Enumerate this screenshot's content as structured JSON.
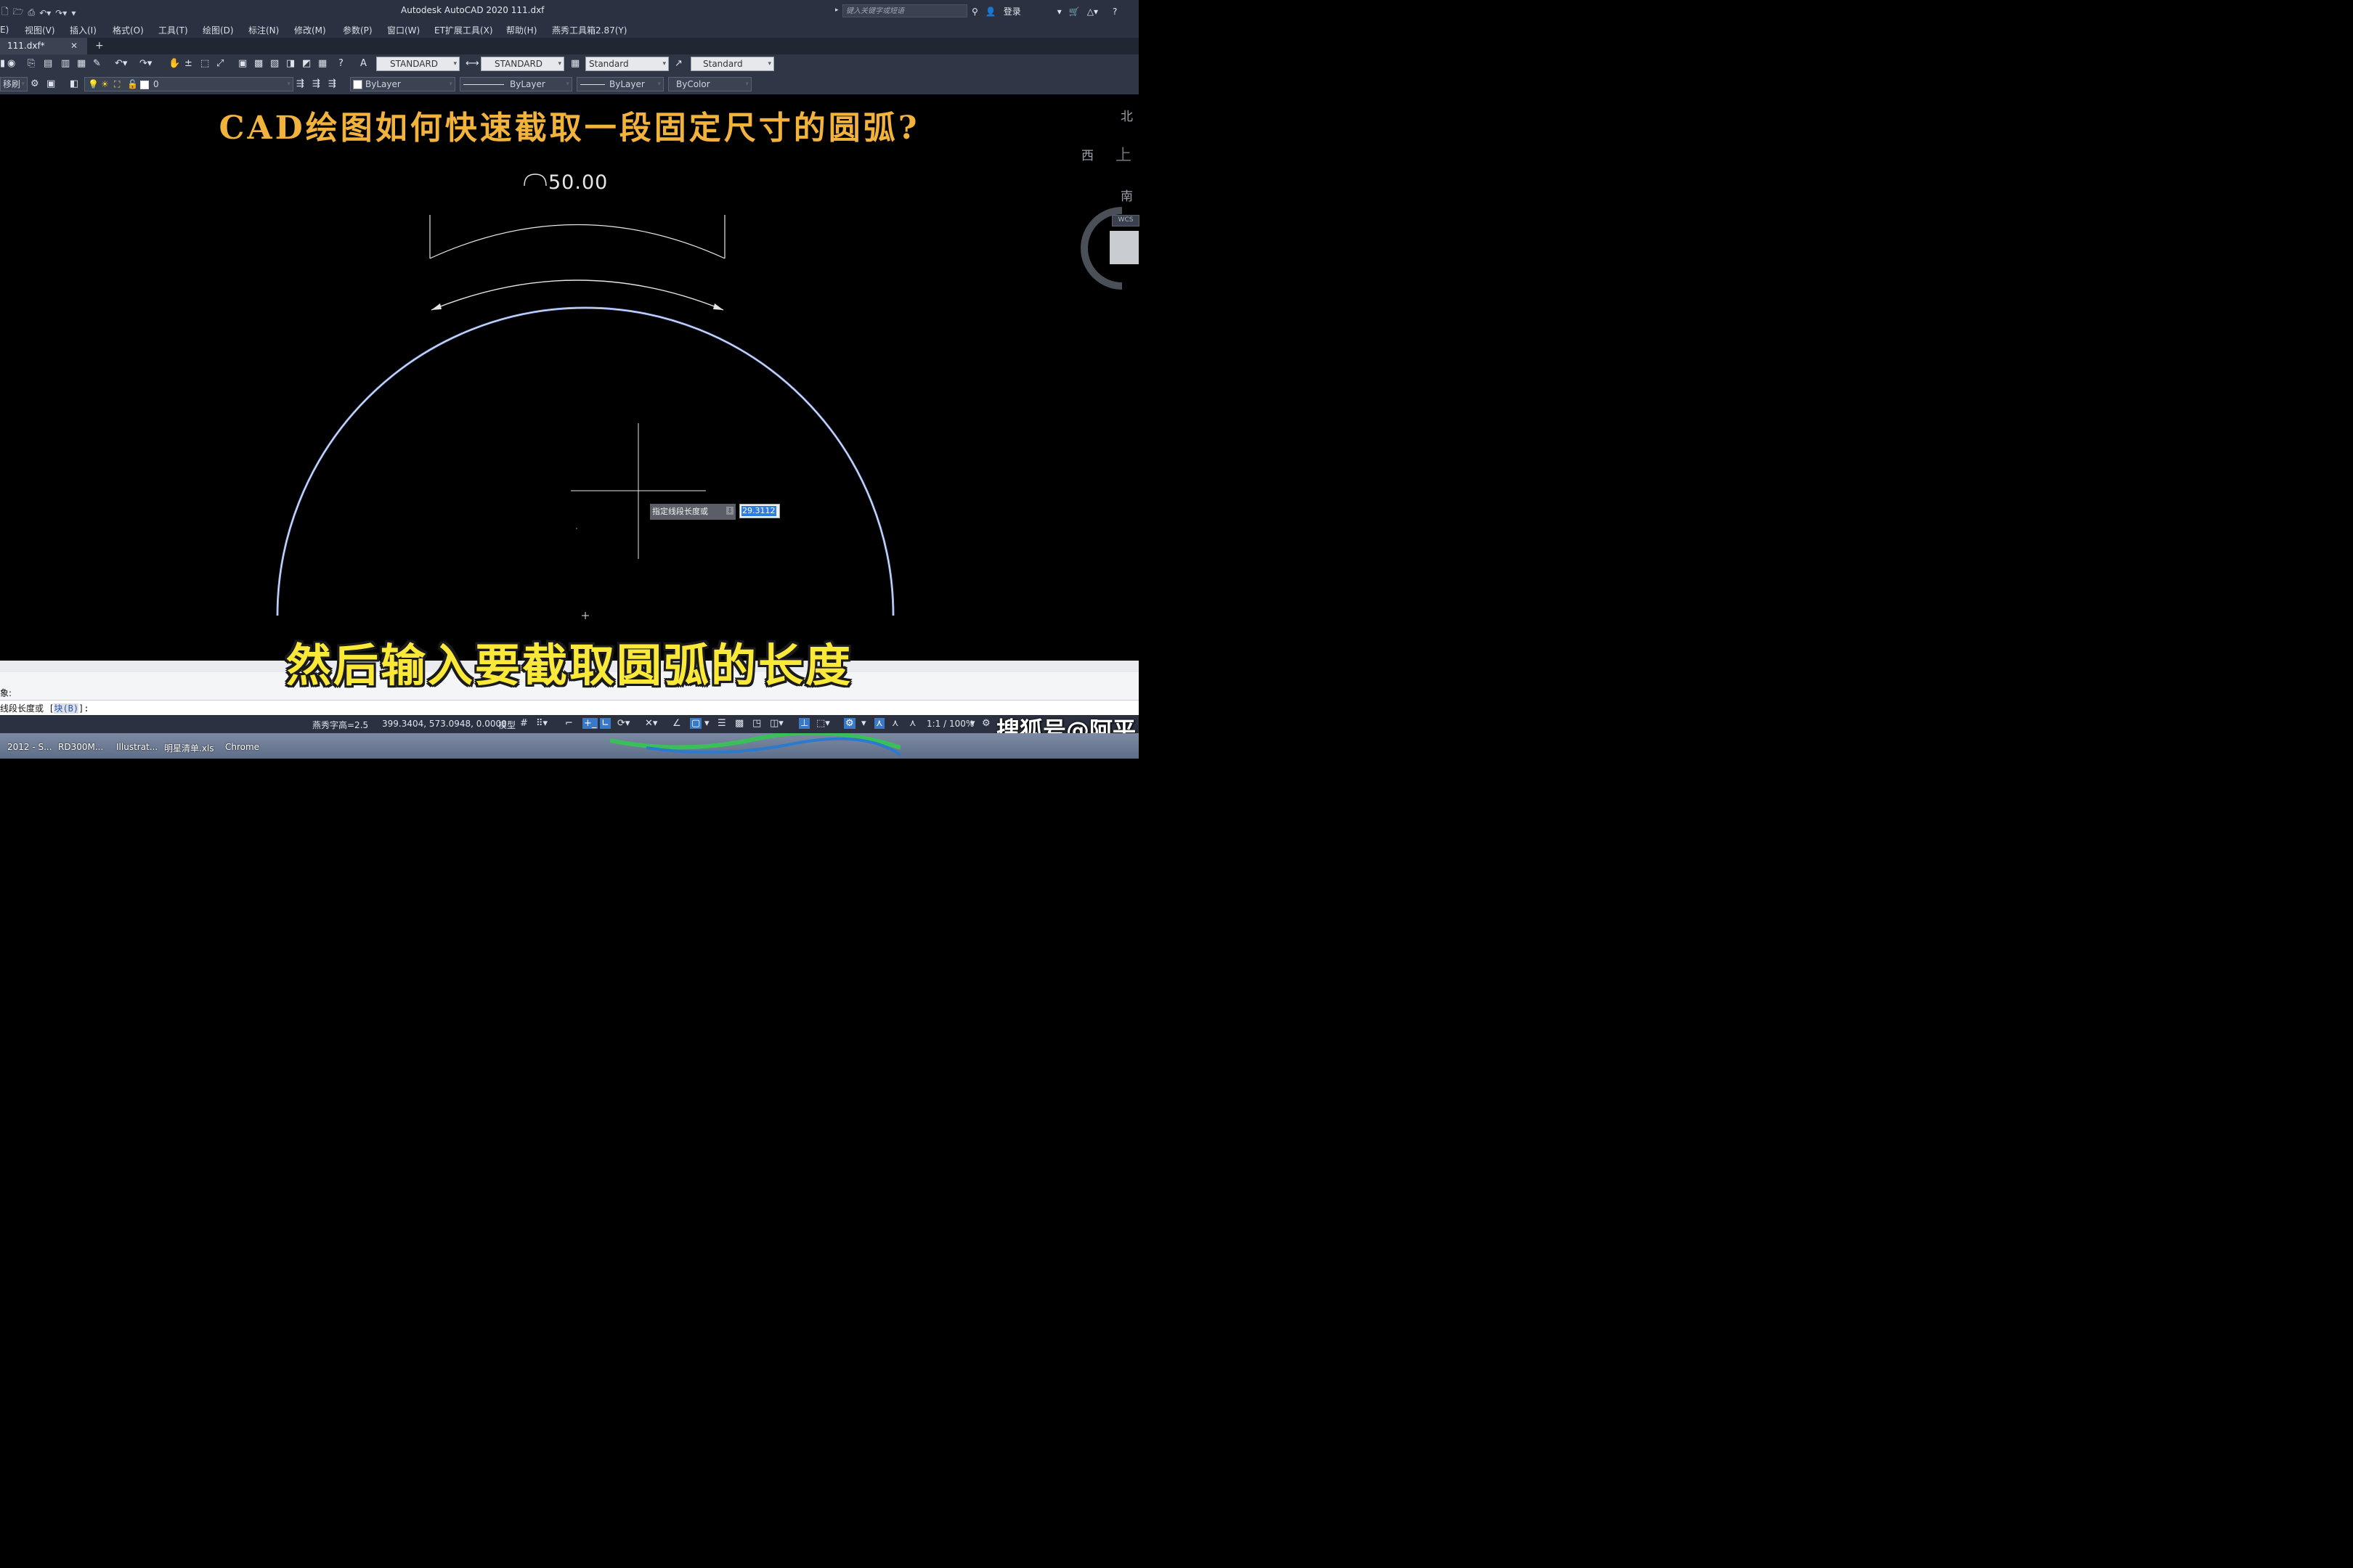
{
  "titlebar": {
    "app_title": "Autodesk AutoCAD 2020    111.dxf",
    "search_placeholder": "键入关键字或短语",
    "login_label": "登录",
    "help_label": "?"
  },
  "menu": {
    "items": [
      "E)",
      "视图(V)",
      "插入(I)",
      "格式(O)",
      "工具(T)",
      "绘图(D)",
      "标注(N)",
      "修改(M)",
      "参数(P)",
      "窗口(W)",
      "ET扩展工具(X)",
      "帮助(H)",
      "燕秀工具箱2.87(Y)"
    ]
  },
  "tabs": {
    "doc_tab": "111.dxf*",
    "close": "✕",
    "add": "+"
  },
  "toolbar1": {
    "text_style": "STANDARD",
    "dim_style": "STANDARD",
    "table_style": "Standard",
    "mleader_style": "Standard"
  },
  "toolbar2": {
    "workspace": "移刷",
    "layer": "0",
    "color": "ByLayer",
    "linetype": "ByLayer",
    "lineweight": "ByLayer",
    "plotstyle": "ByColor"
  },
  "drawing": {
    "video_title": "CAD绘图如何快速截取一段固定尺寸的圆弧?",
    "dimension_text": "50.00",
    "viewcube": {
      "north": "北",
      "west": "西",
      "south": "南",
      "top": "上",
      "wcs": "WCS"
    }
  },
  "dynamic_input": {
    "prompt": "指定线段长度或",
    "lock_glyph": "⇩",
    "value": "29.3112"
  },
  "subtitle": "然后输入要截取圆弧的长度",
  "command": {
    "history": "象:",
    "prompt_prefix": "线段长度或 [",
    "option": "块(B)",
    "prompt_suffix": "]:"
  },
  "statusbar": {
    "text_height": "燕秀字高=2.5",
    "coords": "399.3404, 573.0948, 0.0000",
    "model": "模型",
    "scale": "1:1 / 100%"
  },
  "watermark": "搜狐号@阿平",
  "taskbar": {
    "items": [
      "2012 - S...",
      "RD300M...",
      "Illustrat...",
      "明星清单.xls",
      "Chrome"
    ]
  },
  "colors": {
    "title_yellow": "#f2b33c",
    "subtitle_yellow": "#fbe93a",
    "arc_blue": "#8aa4e6",
    "ui_dark": "#2b3140"
  }
}
